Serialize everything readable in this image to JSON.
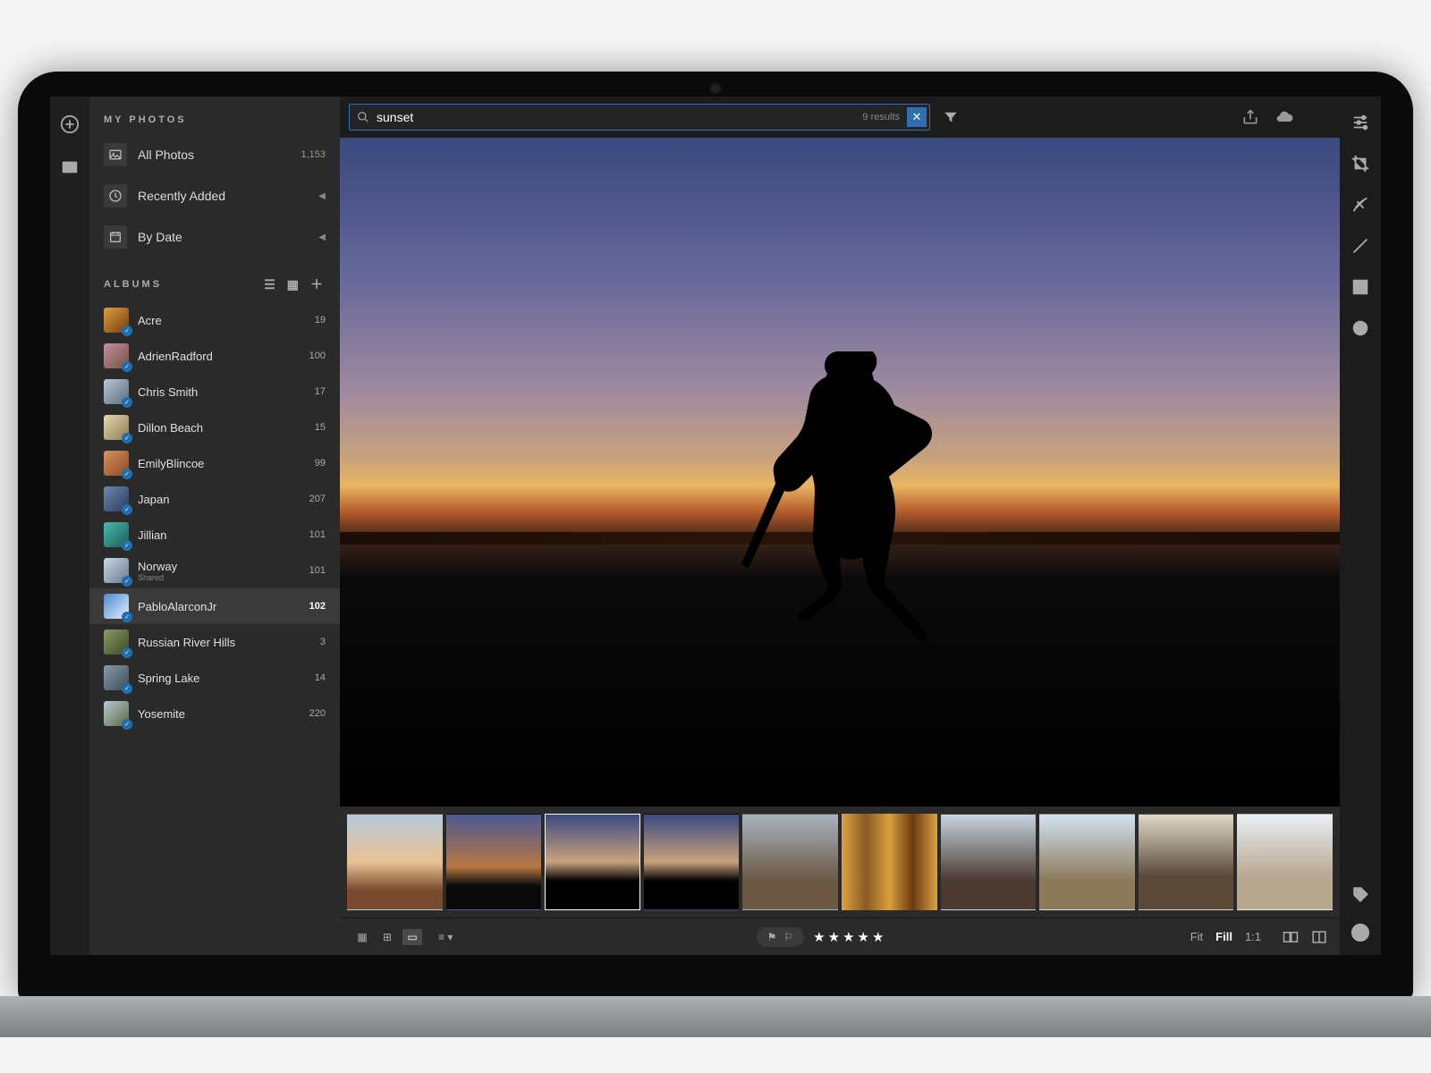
{
  "search": {
    "query": "sunset",
    "results_label": "9 results"
  },
  "sidebar": {
    "my_photos_title": "MY PHOTOS",
    "albums_title": "ALBUMS",
    "nav": [
      {
        "label": "All Photos",
        "count": "1,153",
        "icon": "image"
      },
      {
        "label": "Recently Added",
        "count": "",
        "icon": "clock",
        "chevron": true
      },
      {
        "label": "By Date",
        "count": "",
        "icon": "calendar",
        "chevron": true
      }
    ],
    "albums": [
      {
        "name": "Acre",
        "count": "19",
        "thumb": "linear-gradient(135deg,#d9a040,#7a3a10)"
      },
      {
        "name": "AdrienRadford",
        "count": "100",
        "thumb": "linear-gradient(135deg,#c090a0,#7a5040)"
      },
      {
        "name": "Chris Smith",
        "count": "17",
        "thumb": "linear-gradient(135deg,#b8c8d8,#5a6a7a)"
      },
      {
        "name": "Dillon Beach",
        "count": "15",
        "thumb": "linear-gradient(135deg,#e8d8b0,#8a7a50)"
      },
      {
        "name": "EmilyBlincoe",
        "count": "99",
        "thumb": "linear-gradient(135deg,#d89060,#8a4a20)"
      },
      {
        "name": "Japan",
        "count": "207",
        "thumb": "linear-gradient(135deg,#6a8ab0,#2a3a5a)"
      },
      {
        "name": "Jillian",
        "count": "101",
        "thumb": "linear-gradient(135deg,#4abab0,#1a5a50)"
      },
      {
        "name": "Norway",
        "sub": "Shared",
        "count": "101",
        "thumb": "linear-gradient(135deg,#c8d8e8,#6a7a8a)"
      },
      {
        "name": "PabloAlarconJr",
        "count": "102",
        "thumb": "linear-gradient(135deg,#4a8ad0,#e8f0f8)",
        "selected": true
      },
      {
        "name": "Russian River Hills",
        "count": "3",
        "thumb": "linear-gradient(135deg,#8a9a6a,#3a4a20)"
      },
      {
        "name": "Spring Lake",
        "count": "14",
        "thumb": "linear-gradient(135deg,#8a9aa8,#3a4a58)"
      },
      {
        "name": "Yosemite",
        "count": "220",
        "thumb": "linear-gradient(135deg,#b8c8d8,#5a6a3a)"
      }
    ]
  },
  "filmstrip": [
    {
      "class": "g-sunset1"
    },
    {
      "class": "g-sunset2"
    },
    {
      "class": "g-sunset3",
      "selected": true
    },
    {
      "class": "g-sunset3"
    },
    {
      "class": "g-cliff"
    },
    {
      "class": "g-forest"
    },
    {
      "class": "g-crowd"
    },
    {
      "class": "g-jump"
    },
    {
      "class": "g-rocks"
    },
    {
      "class": "g-beach"
    }
  ],
  "bottombar": {
    "stars": "★★★★★",
    "zoom": {
      "fit": "Fit",
      "fill": "Fill",
      "one_to_one": "1:1"
    }
  }
}
